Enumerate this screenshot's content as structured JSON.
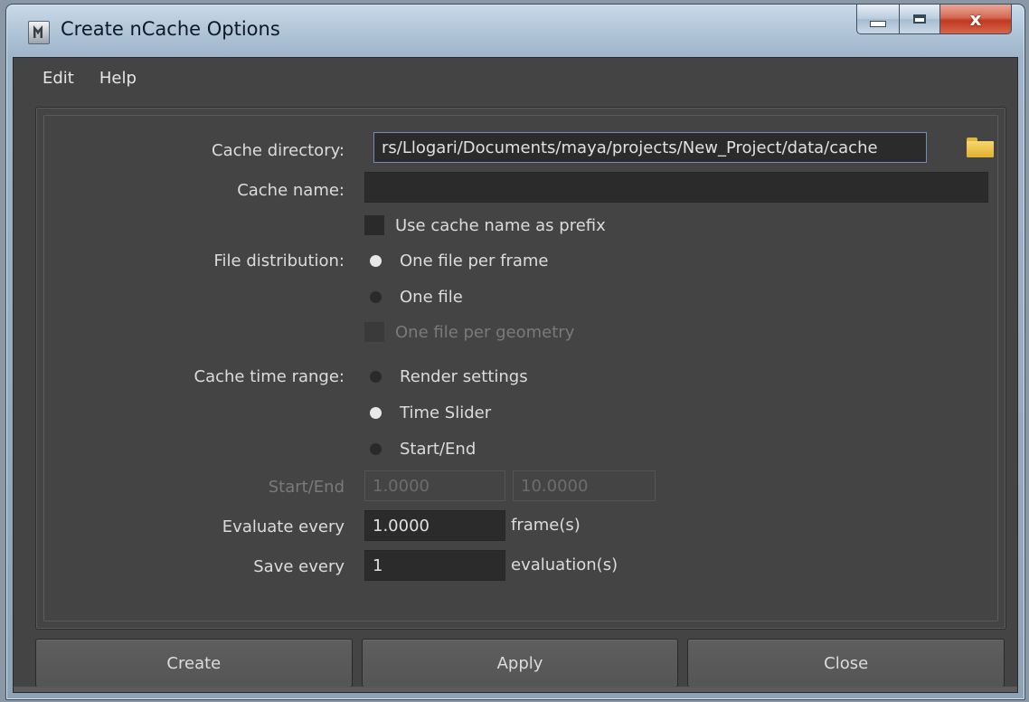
{
  "window": {
    "title": "Create nCache Options",
    "controls": {
      "minimize": "minimize",
      "maximize": "maximize",
      "close": "x"
    }
  },
  "menu": {
    "items": [
      "Edit",
      "Help"
    ]
  },
  "form": {
    "cache_directory": {
      "label": "Cache directory:",
      "value": "rs/Llogari/Documents/maya/projects/New_Project/data/cache",
      "icon": "folder-icon"
    },
    "cache_name": {
      "label": "Cache name:",
      "value": ""
    },
    "use_prefix": {
      "label": "Use cache name as prefix",
      "checked": false
    },
    "file_distribution": {
      "label": "File distribution:",
      "options": [
        {
          "label": "One file per frame",
          "selected": true
        },
        {
          "label": "One file",
          "selected": false
        }
      ],
      "per_geometry": {
        "label": "One file per geometry",
        "checked": false,
        "enabled": false
      }
    },
    "time_range": {
      "label": "Cache time range:",
      "options": [
        {
          "label": "Render settings",
          "selected": false
        },
        {
          "label": "Time Slider",
          "selected": true
        },
        {
          "label": "Start/End",
          "selected": false
        }
      ]
    },
    "start_end": {
      "label": "Start/End",
      "start": "1.0000",
      "end": "10.0000",
      "enabled": false
    },
    "evaluate_every": {
      "label": "Evaluate every",
      "value": "1.0000",
      "unit": "frame(s)"
    },
    "save_every": {
      "label": "Save every",
      "value": "1",
      "unit": "evaluation(s)"
    }
  },
  "buttons": {
    "create": "Create",
    "apply": "Apply",
    "close": "Close"
  },
  "colors": {
    "panel_bg": "#444444",
    "field_bg": "#2b2b2b",
    "accent_border": "#6f8eb8",
    "folder": "#f1c84e"
  }
}
